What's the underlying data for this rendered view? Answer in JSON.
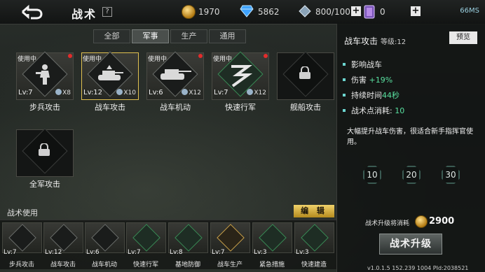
{
  "header": {
    "title": "战术",
    "help": "?",
    "gold": "1970",
    "diamonds": "5862",
    "crystal": "800/100",
    "tickets": "0",
    "network": "66MS"
  },
  "tabs": [
    {
      "label": "全部",
      "active": false
    },
    {
      "label": "军事",
      "active": true
    },
    {
      "label": "生产",
      "active": false
    },
    {
      "label": "通用",
      "active": false
    }
  ],
  "tactics": [
    {
      "name": "步兵攻击",
      "in_use": "使用中",
      "level": "Lv:7",
      "count": "X8",
      "icon": "infantry-icon",
      "style": "plain"
    },
    {
      "name": "战车攻击",
      "in_use": "使用中",
      "level": "Lv:12",
      "count": "X10",
      "icon": "tank-attack-icon",
      "style": "plain"
    },
    {
      "name": "战车机动",
      "in_use": "使用中",
      "level": "Lv:6",
      "count": "X12",
      "icon": "tank-move-icon",
      "style": "plain"
    },
    {
      "name": "快速行军",
      "in_use": "使用中",
      "level": "Lv:7",
      "count": "X12",
      "icon": "march-icon",
      "style": "green"
    },
    {
      "name": "舰船攻击",
      "in_use": "",
      "level": "",
      "count": "",
      "icon": "lock-icon",
      "style": "locked"
    },
    {
      "name": "全军攻击",
      "in_use": "",
      "level": "",
      "count": "",
      "icon": "lock-icon",
      "style": "locked"
    }
  ],
  "used_section": {
    "title": "战术使用",
    "edit_label": "编 辑",
    "slots": [
      {
        "name": "步兵攻击",
        "level": "Lv:7",
        "style": "plain"
      },
      {
        "name": "战车攻击",
        "level": "Lv:12",
        "style": "plain"
      },
      {
        "name": "战车机动",
        "level": "Lv:6",
        "style": "plain"
      },
      {
        "name": "快速行军",
        "level": "Lv:7",
        "style": "green"
      },
      {
        "name": "基地防御",
        "level": "Lv:8",
        "style": "green"
      },
      {
        "name": "战车生产",
        "level": "Lv:7",
        "style": "gold"
      },
      {
        "name": "紧急措施",
        "level": "Lv:3",
        "style": "green"
      },
      {
        "name": "快速建造",
        "level": "Lv:3",
        "style": "green"
      }
    ]
  },
  "detail": {
    "title": "战车攻击",
    "level_label": "等级:12",
    "preview_label": "预览",
    "attrs": [
      {
        "label": "影响战车",
        "value": ""
      },
      {
        "label": "伤害 ",
        "value": "+19%"
      },
      {
        "label": "持续时间",
        "value": "44秒"
      },
      {
        "label": "战术点消耗: ",
        "value": "10"
      }
    ],
    "description": "大幅提升战车伤害，很适合新手指挥官使用。",
    "levels": [
      "10",
      "20",
      "30"
    ],
    "cost_label": "战术升级将消耗",
    "cost_value": "2900",
    "upgrade_label": "战术升级"
  },
  "version": "v1.0.1.5 152.239 1004 PId:2038521"
}
